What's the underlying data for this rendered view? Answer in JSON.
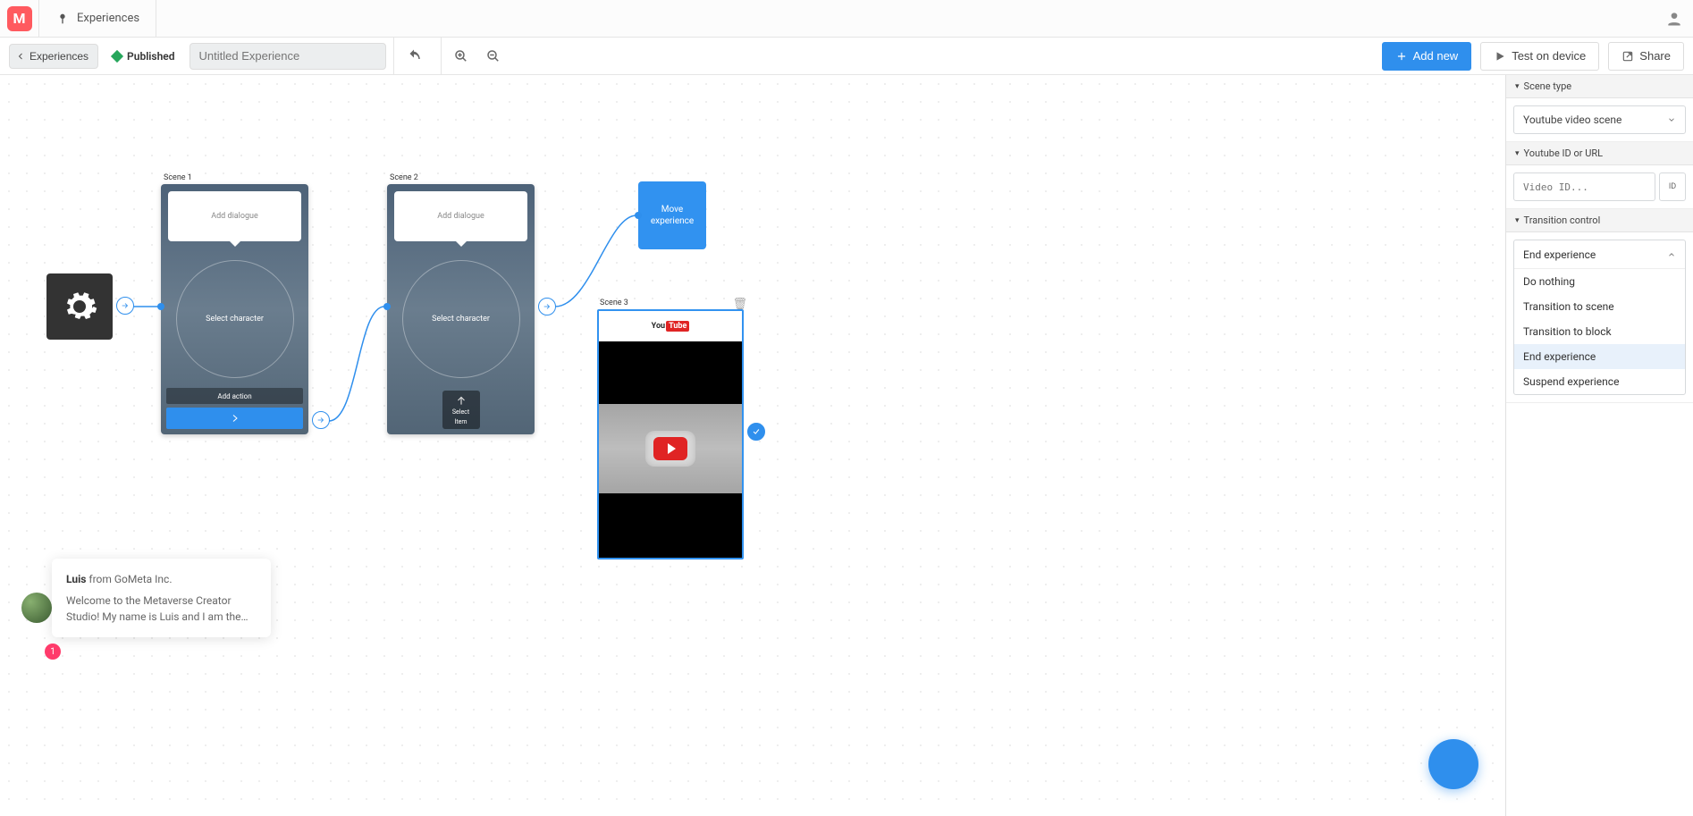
{
  "appbar": {
    "tab": "Experiences"
  },
  "toolbar": {
    "breadcrumb": "Experiences",
    "status": "Published",
    "title_placeholder": "Untitled Experience",
    "add_new": "Add new",
    "test": "Test on device",
    "share": "Share"
  },
  "canvas": {
    "scene1": {
      "label": "Scene 1",
      "dialogue": "Add dialogue",
      "character": "Select character",
      "action": "Add action"
    },
    "scene2": {
      "label": "Scene 2",
      "dialogue": "Add dialogue",
      "character": "Select character",
      "item1": "Select",
      "item2": "Item"
    },
    "scene3": {
      "label": "Scene 3"
    },
    "move_tag_l1": "Move",
    "move_tag_l2": "experience"
  },
  "inspector": {
    "section1": "Scene type",
    "scene_type": "Youtube video scene",
    "section2": "Youtube ID or URL",
    "video_placeholder": "Video ID...",
    "id_label": "ID",
    "section3": "Transition control",
    "transition_current": "End experience",
    "options": {
      "o0": "Do nothing",
      "o1": "Transition to scene",
      "o2": "Transition to block",
      "o3": "End experience",
      "o4": "Suspend experience"
    }
  },
  "chat": {
    "sender": "Luis",
    "from": " from GoMeta Inc.",
    "body": "Welcome to the Metaverse Creator Studio!  My name is Luis and I am the…",
    "badge": "1"
  }
}
